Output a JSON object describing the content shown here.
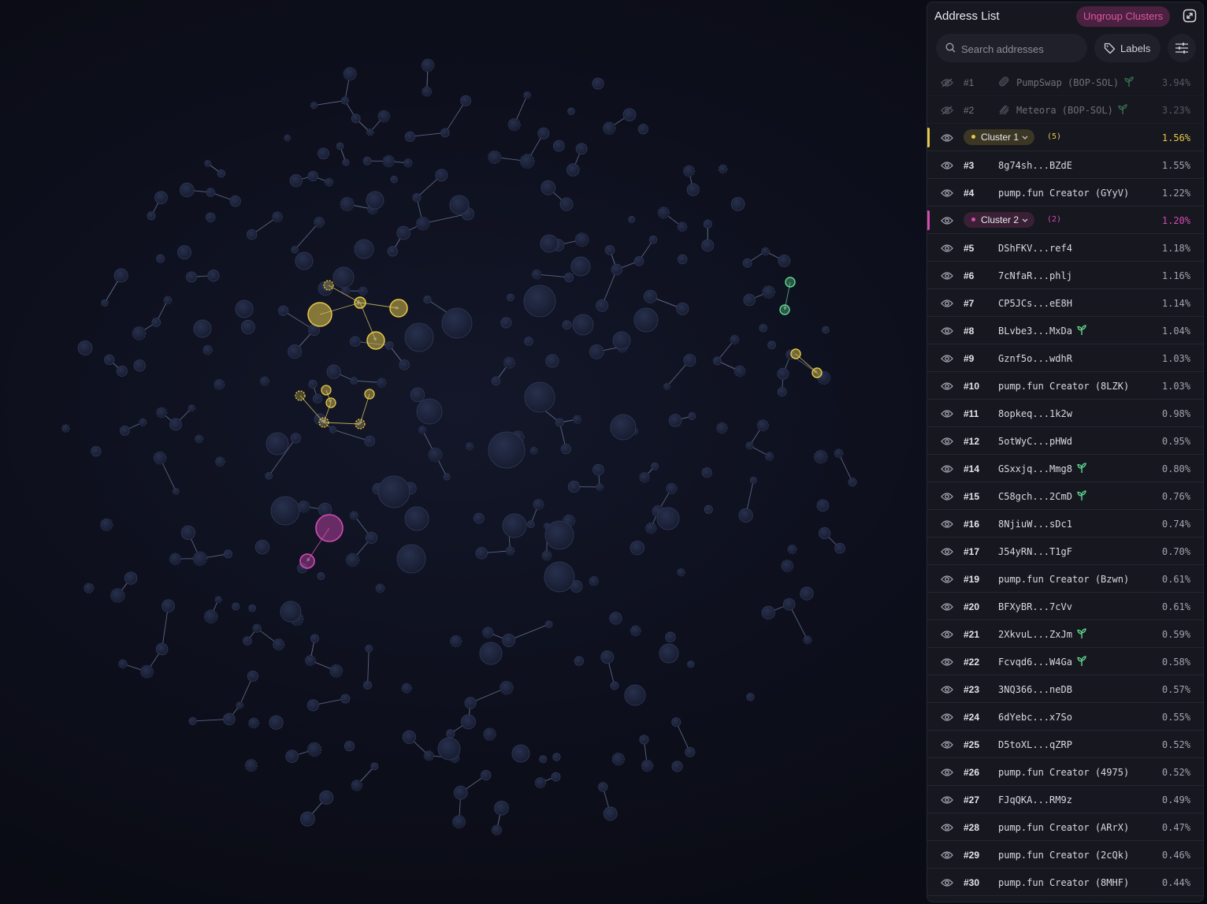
{
  "panel": {
    "title": "Address List",
    "ungroup_label": "Ungroup Clusters",
    "search_placeholder": "Search addresses",
    "labels_label": "Labels"
  },
  "colors": {
    "cluster1": "#e6c94a",
    "cluster2": "#d44bb5",
    "green": "#5fd98f",
    "node_fill": "#1c2137",
    "node_stroke": "#2c3452"
  },
  "rows": [
    {
      "type": "address",
      "rank": "#1",
      "name": "PumpSwap (BOP-SOL)",
      "pct": "3.94%",
      "hidden": true,
      "lp_icon": "pill-icon",
      "sprout": true
    },
    {
      "type": "address",
      "rank": "#2",
      "name": "Meteora (BOP-SOL)",
      "pct": "3.23%",
      "hidden": true,
      "lp_icon": "meteora-icon",
      "sprout": true
    },
    {
      "type": "cluster",
      "name": "Cluster 1",
      "count": "(5)",
      "pct": "1.56%",
      "color": "#e6c94a",
      "pill_bg": "#3c3624"
    },
    {
      "type": "address",
      "rank": "#3",
      "name": "8g74sh...BZdE",
      "pct": "1.55%"
    },
    {
      "type": "address",
      "rank": "#4",
      "name": "pump.fun Creator (GYyV)",
      "pct": "1.22%"
    },
    {
      "type": "cluster",
      "name": "Cluster 2",
      "count": "(2)",
      "pct": "1.20%",
      "color": "#d44bb5",
      "pill_bg": "#3a2035"
    },
    {
      "type": "address",
      "rank": "#5",
      "name": "DShFKV...ref4",
      "pct": "1.18%"
    },
    {
      "type": "address",
      "rank": "#6",
      "name": "7cNfaR...phlj",
      "pct": "1.16%"
    },
    {
      "type": "address",
      "rank": "#7",
      "name": "CP5JCs...eE8H",
      "pct": "1.14%"
    },
    {
      "type": "address",
      "rank": "#8",
      "name": "BLvbe3...MxDa",
      "pct": "1.04%",
      "sprout": true
    },
    {
      "type": "address",
      "rank": "#9",
      "name": "Gznf5o...wdhR",
      "pct": "1.03%"
    },
    {
      "type": "address",
      "rank": "#10",
      "name": "pump.fun Creator (8LZK)",
      "pct": "1.03%"
    },
    {
      "type": "address",
      "rank": "#11",
      "name": "8opkeq...1k2w",
      "pct": "0.98%"
    },
    {
      "type": "address",
      "rank": "#12",
      "name": "5otWyC...pHWd",
      "pct": "0.95%"
    },
    {
      "type": "address",
      "rank": "#14",
      "name": "GSxxjq...Mmg8",
      "pct": "0.80%",
      "sprout": true
    },
    {
      "type": "address",
      "rank": "#15",
      "name": "C58gch...2CmD",
      "pct": "0.76%",
      "sprout": true
    },
    {
      "type": "address",
      "rank": "#16",
      "name": "8NjiuW...sDc1",
      "pct": "0.74%"
    },
    {
      "type": "address",
      "rank": "#17",
      "name": "J54yRN...T1gF",
      "pct": "0.70%"
    },
    {
      "type": "address",
      "rank": "#19",
      "name": "pump.fun Creator (Bzwn)",
      "pct": "0.61%"
    },
    {
      "type": "address",
      "rank": "#20",
      "name": "BFXyBR...7cVv",
      "pct": "0.61%"
    },
    {
      "type": "address",
      "rank": "#21",
      "name": "2XkvuL...ZxJm",
      "pct": "0.59%",
      "sprout": true
    },
    {
      "type": "address",
      "rank": "#22",
      "name": "Fcvqd6...W4Ga",
      "pct": "0.58%",
      "sprout": true
    },
    {
      "type": "address",
      "rank": "#23",
      "name": "3NQ366...neDB",
      "pct": "0.57%"
    },
    {
      "type": "address",
      "rank": "#24",
      "name": "6dYebc...x7So",
      "pct": "0.55%"
    },
    {
      "type": "address",
      "rank": "#25",
      "name": "D5toXL...qZRP",
      "pct": "0.52%"
    },
    {
      "type": "address",
      "rank": "#26",
      "name": "pump.fun Creator (4975)",
      "pct": "0.52%"
    },
    {
      "type": "address",
      "rank": "#27",
      "name": "FJqQKA...RM9z",
      "pct": "0.49%"
    },
    {
      "type": "address",
      "rank": "#28",
      "name": "pump.fun Creator (ARrX)",
      "pct": "0.47%"
    },
    {
      "type": "address",
      "rank": "#29",
      "name": "pump.fun Creator (2cQk)",
      "pct": "0.46%"
    },
    {
      "type": "address",
      "rank": "#30",
      "name": "pump.fun Creator (8MHF)",
      "pct": "0.44%"
    }
  ]
}
